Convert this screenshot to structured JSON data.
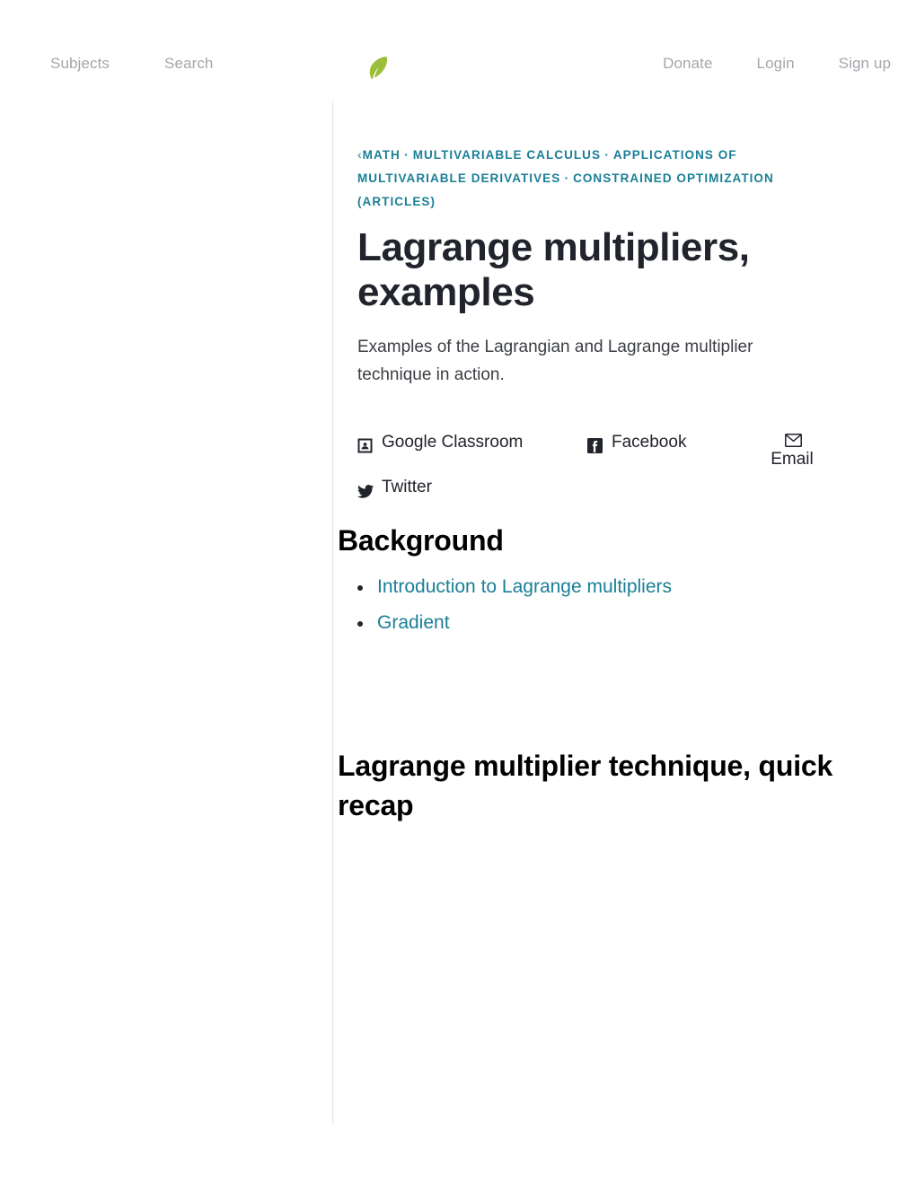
{
  "header": {
    "logo_icon": "khan-academy-leaf-icon",
    "logo_color": "#9cbf3b",
    "left_nav": [
      {
        "label": "Subjects",
        "name": "subjects"
      },
      {
        "label": "Search",
        "name": "search"
      }
    ],
    "right_nav": [
      {
        "label": "Donate",
        "name": "donate"
      },
      {
        "label": "Login",
        "name": "login"
      },
      {
        "label": "Sign up",
        "name": "signup"
      }
    ],
    "nav_text_color": "#a3a7ac"
  },
  "article": {
    "breadcrumb": {
      "back_chevron": "‹",
      "separator": "·",
      "items": [
        "MATH",
        "MULTIVARIABLE CALCULUS",
        "APPLICATIONS OF MULTIVARIABLE DERIVATIVES",
        "CONSTRAINED OPTIMIZATION (ARTICLES)"
      ],
      "color": "#1a7f96"
    },
    "title": "Lagrange multipliers, examples",
    "description": "Examples of the Lagrangian and Lagrange multiplier technique in action."
  },
  "share": {
    "google_classroom": {
      "label": "Google Classroom",
      "icon": "google-classroom-icon"
    },
    "facebook": {
      "label": "Facebook",
      "icon": "facebook-icon"
    },
    "email": {
      "label": "Email",
      "icon": "envelope-icon"
    },
    "twitter": {
      "label": "Twitter",
      "icon": "twitter-bird-icon"
    }
  },
  "sections": [
    {
      "heading": "Background",
      "links": [
        "Introduction to Lagrange multipliers",
        "Gradient"
      ]
    },
    {
      "heading": "Lagrange multiplier technique, quick recap"
    }
  ],
  "colors": {
    "link": "#1a7f96",
    "text": "#21242c",
    "divider": "#e3e5e7",
    "background": "#ffffff"
  }
}
